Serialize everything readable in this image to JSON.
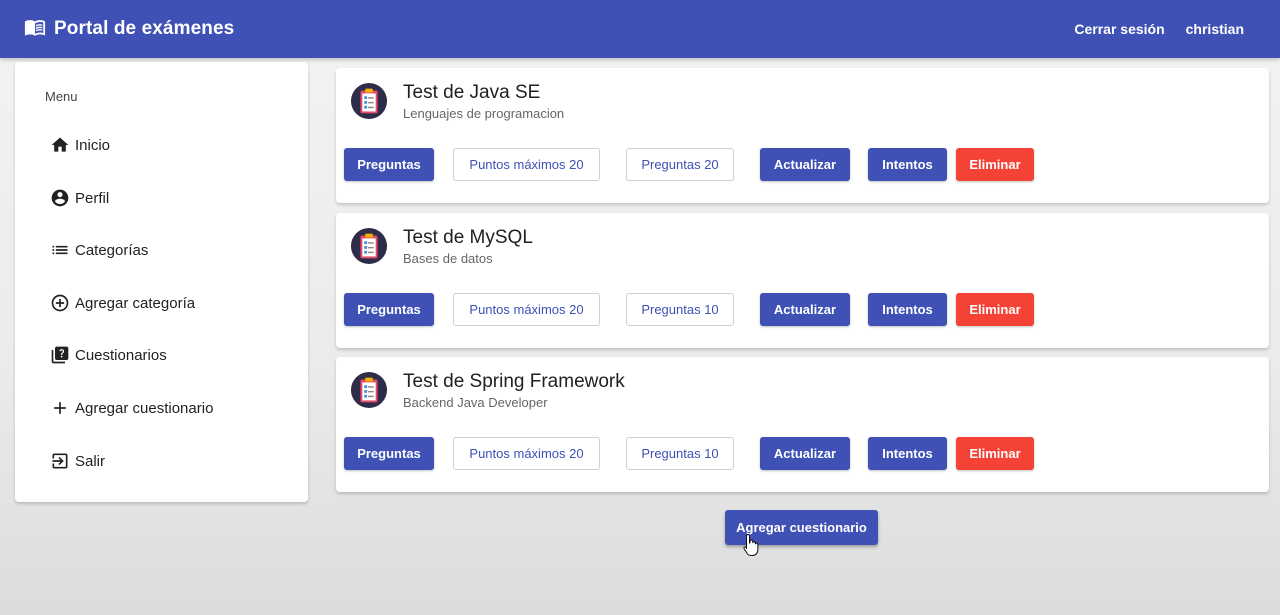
{
  "header": {
    "title": "Portal de exámenes",
    "logout_label": "Cerrar sesión",
    "username": "christian",
    "background_color": "#3f51b5",
    "brand_icon": "book-open-icon"
  },
  "sidebar": {
    "menu_header": "Menu",
    "items": [
      {
        "label": "Inicio",
        "icon": "home-icon"
      },
      {
        "label": "Perfil",
        "icon": "account-circle-icon"
      },
      {
        "label": "Categorías",
        "icon": "list-icon"
      },
      {
        "label": "Agregar categoría",
        "icon": "add-circle-icon"
      },
      {
        "label": "Cuestionarios",
        "icon": "quiz-icon"
      },
      {
        "label": "Agregar cuestionario",
        "icon": "add-icon"
      },
      {
        "label": "Salir",
        "icon": "logout-icon"
      }
    ]
  },
  "quizzes": [
    {
      "title": "Test de Java SE",
      "category": "Lenguajes de programacion",
      "questions_label": "Preguntas",
      "max_points_label": "Puntos máximos 20",
      "num_questions_label": "Preguntas 20",
      "update_label": "Actualizar",
      "attempts_label": "Intentos",
      "delete_label": "Eliminar"
    },
    {
      "title": "Test de MySQL",
      "category": "Bases de datos",
      "questions_label": "Preguntas",
      "max_points_label": "Puntos máximos 20",
      "num_questions_label": "Preguntas 10",
      "update_label": "Actualizar",
      "attempts_label": "Intentos",
      "delete_label": "Eliminar"
    },
    {
      "title": "Test de Spring Framework",
      "category": "Backend Java Developer",
      "questions_label": "Preguntas",
      "max_points_label": "Puntos máximos 20",
      "num_questions_label": "Preguntas 10",
      "update_label": "Actualizar",
      "attempts_label": "Intentos",
      "delete_label": "Eliminar"
    }
  ],
  "add_quiz_button_label": "Agregar cuestionario",
  "colors": {
    "primary": "#3f51b5",
    "warn": "#f44336"
  }
}
